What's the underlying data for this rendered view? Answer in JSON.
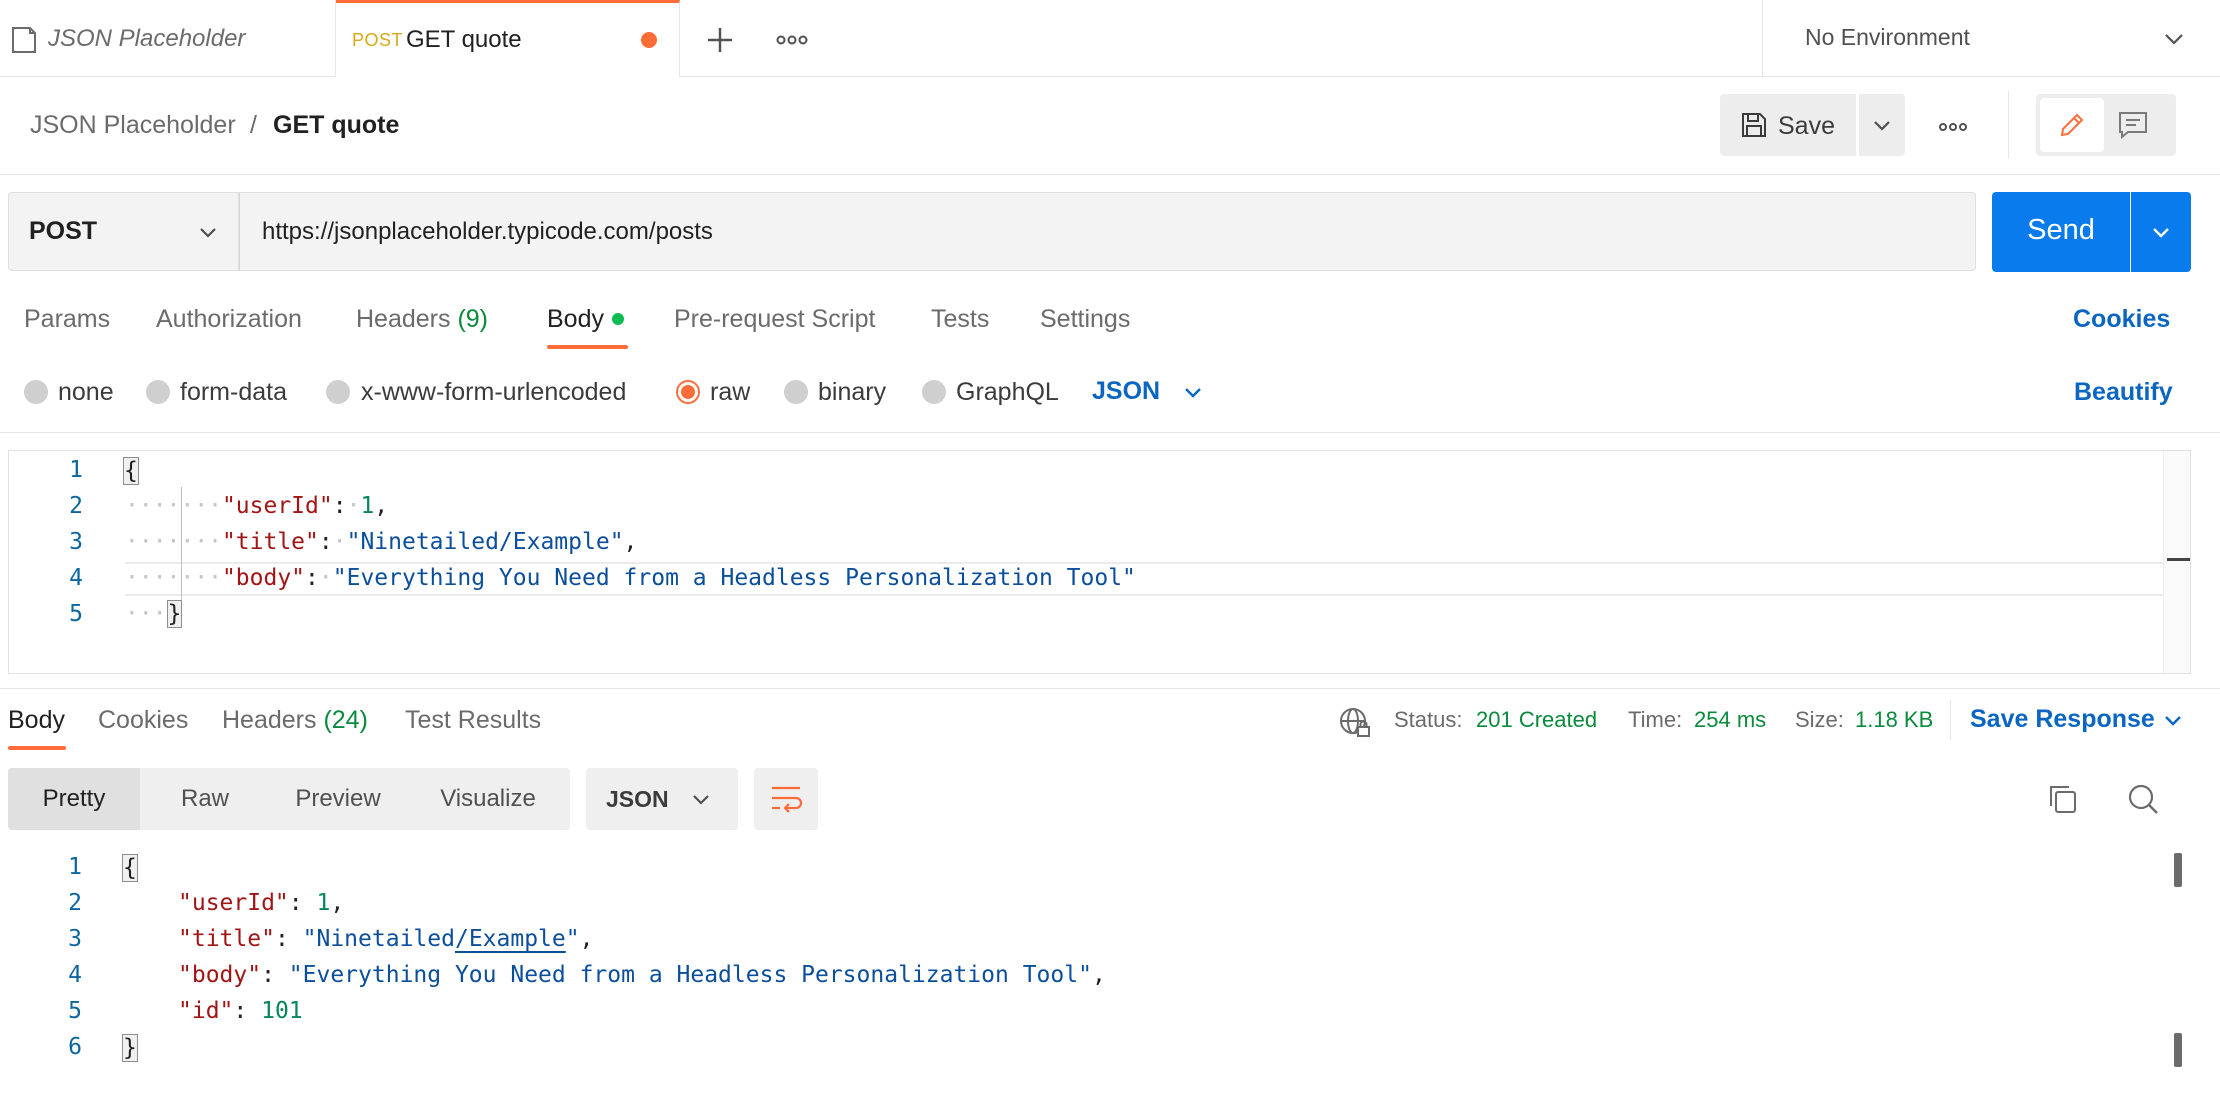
{
  "tabs": [
    {
      "label": "JSON Placeholder",
      "method": ""
    },
    {
      "label": "GET quote",
      "method": "POST",
      "unsaved": true
    }
  ],
  "environment": {
    "label": "No Environment"
  },
  "breadcrumb": {
    "collection": "JSON Placeholder",
    "separator": "/",
    "request": "GET quote"
  },
  "toolbar": {
    "save_label": "Save"
  },
  "request": {
    "method": "POST",
    "url": "https://jsonplaceholder.typicode.com/posts",
    "send_label": "Send"
  },
  "request_tabs": {
    "params": "Params",
    "authorization": "Authorization",
    "headers": "Headers",
    "headers_count": "(9)",
    "body": "Body",
    "pre_request": "Pre-request Script",
    "tests": "Tests",
    "settings": "Settings",
    "cookies": "Cookies"
  },
  "body_types": {
    "none": "none",
    "form_data": "form-data",
    "urlencoded": "x-www-form-urlencoded",
    "raw": "raw",
    "binary": "binary",
    "graphql": "GraphQL",
    "selected": "raw",
    "language": "JSON",
    "beautify": "Beautify"
  },
  "request_body": {
    "line_numbers": [
      "1",
      "2",
      "3",
      "4",
      "5"
    ],
    "open_brace": "{",
    "close_brace": "}",
    "fields": [
      {
        "key": "\"userId\"",
        "value": "1",
        "trail": ","
      },
      {
        "key": "\"title\"",
        "value": "\"Ninetailed/Example\"",
        "trail": ","
      },
      {
        "key": "\"body\"",
        "value": "\"Everything You Need from a Headless Personalization Tool\"",
        "trail": ""
      }
    ]
  },
  "response_tabs": {
    "body": "Body",
    "cookies": "Cookies",
    "headers": "Headers",
    "headers_count": "(24)",
    "test_results": "Test Results"
  },
  "status": {
    "status_label": "Status:",
    "status_value": "201 Created",
    "time_label": "Time:",
    "time_value": "254 ms",
    "size_label": "Size:",
    "size_value": "1.18 KB",
    "save_response": "Save Response"
  },
  "view_modes": {
    "pretty": "Pretty",
    "raw": "Raw",
    "preview": "Preview",
    "visualize": "Visualize",
    "format": "JSON"
  },
  "response_body": {
    "line_numbers": [
      "1",
      "2",
      "3",
      "4",
      "5",
      "6"
    ],
    "open_brace": "{",
    "close_brace": "}",
    "fields": [
      {
        "key": "\"userId\"",
        "value": "1",
        "trail": ","
      },
      {
        "key": "\"title\"",
        "value_a": "\"Ninetailed",
        "value_b": "/Example",
        "value_c": "\"",
        "trail": ","
      },
      {
        "key": "\"body\"",
        "value": "\"Everything You Need from a Headless Personalization Tool\"",
        "trail": ","
      },
      {
        "key": "\"id\"",
        "value": "101",
        "trail": ""
      }
    ]
  },
  "colors": {
    "accent": "#ff6c37",
    "primary_blue": "#097bed",
    "link_blue": "#0b66c2",
    "success_green": "#0b8a3c",
    "method_post": "#d9a71a"
  },
  "icons": {
    "collection": "collection-icon",
    "plus": "plus-icon",
    "more": "more-horizontal-icon",
    "chevron": "chevron-down-icon",
    "save": "floppy-disk-icon",
    "edit": "pencil-icon",
    "comment": "comment-icon",
    "globe": "globe-lock-icon",
    "wrap": "wrap-lines-icon",
    "copy": "copy-icon",
    "search": "search-icon"
  }
}
